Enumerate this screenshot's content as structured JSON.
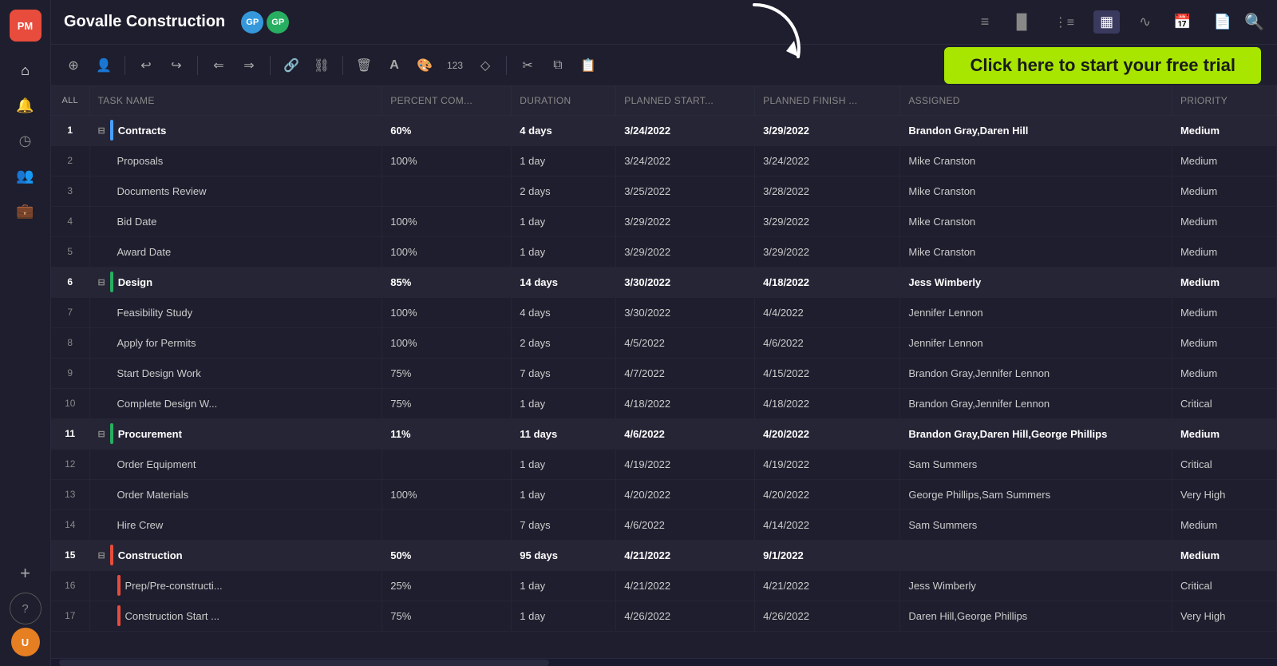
{
  "app": {
    "logo": "PM",
    "project_title": "Govalle Construction",
    "free_trial_text": "Click here to start your free trial"
  },
  "sidebar": {
    "icons": [
      {
        "name": "home-icon",
        "symbol": "⌂"
      },
      {
        "name": "bell-icon",
        "symbol": "🔔"
      },
      {
        "name": "clock-icon",
        "symbol": "◷"
      },
      {
        "name": "people-icon",
        "symbol": "👥"
      },
      {
        "name": "briefcase-icon",
        "symbol": "💼"
      }
    ],
    "bottom_icons": [
      {
        "name": "plus-icon",
        "symbol": "+"
      },
      {
        "name": "help-icon",
        "symbol": "?"
      }
    ]
  },
  "toolbar": {
    "buttons": [
      {
        "name": "add-task-btn",
        "symbol": "⊕"
      },
      {
        "name": "add-person-btn",
        "symbol": "👤"
      },
      {
        "name": "undo-btn",
        "symbol": "↩"
      },
      {
        "name": "redo-btn",
        "symbol": "↪"
      },
      {
        "name": "outdent-btn",
        "symbol": "⇐"
      },
      {
        "name": "indent-btn",
        "symbol": "⇒"
      },
      {
        "name": "link-btn",
        "symbol": "🔗"
      },
      {
        "name": "unlink-btn",
        "symbol": "⛓"
      },
      {
        "name": "delete-btn",
        "symbol": "🗑"
      },
      {
        "name": "font-btn",
        "symbol": "A"
      },
      {
        "name": "paint-btn",
        "symbol": "🎨"
      },
      {
        "name": "number-btn",
        "symbol": "123"
      },
      {
        "name": "shape-btn",
        "symbol": "◇"
      },
      {
        "name": "cut-btn",
        "symbol": "✂"
      },
      {
        "name": "copy-btn",
        "symbol": "⧉"
      },
      {
        "name": "paste-btn",
        "symbol": "📋"
      }
    ]
  },
  "header": {
    "view_icons": [
      {
        "name": "list-view-icon",
        "symbol": "≡",
        "active": false
      },
      {
        "name": "chart-view-icon",
        "symbol": "▐▌",
        "active": false
      },
      {
        "name": "gantt-view-icon",
        "symbol": "≡",
        "active": false
      },
      {
        "name": "grid-view-icon",
        "symbol": "▦",
        "active": true
      },
      {
        "name": "pulse-view-icon",
        "symbol": "∿",
        "active": false
      },
      {
        "name": "calendar-view-icon",
        "symbol": "📅",
        "active": false
      },
      {
        "name": "file-view-icon",
        "symbol": "📄",
        "active": false
      }
    ]
  },
  "table": {
    "columns": [
      {
        "key": "all",
        "label": "ALL"
      },
      {
        "key": "task_name",
        "label": "TASK NAME"
      },
      {
        "key": "percent",
        "label": "PERCENT COM..."
      },
      {
        "key": "duration",
        "label": "DURATION"
      },
      {
        "key": "planned_start",
        "label": "PLANNED START..."
      },
      {
        "key": "planned_finish",
        "label": "PLANNED FINISH ..."
      },
      {
        "key": "assigned",
        "label": "ASSIGNED"
      },
      {
        "key": "priority",
        "label": "PRIORITY"
      }
    ],
    "rows": [
      {
        "id": 1,
        "type": "group",
        "color": "blue",
        "task": "Contracts",
        "percent": "60%",
        "duration": "4 days",
        "start": "3/24/2022",
        "finish": "3/29/2022",
        "assigned": "Brandon Gray,Daren Hill",
        "priority": "Medium"
      },
      {
        "id": 2,
        "type": "task",
        "indent": true,
        "task": "Proposals",
        "percent": "100%",
        "duration": "1 day",
        "start": "3/24/2022",
        "finish": "3/24/2022",
        "assigned": "Mike Cranston",
        "priority": "Medium"
      },
      {
        "id": 3,
        "type": "task",
        "indent": true,
        "task": "Documents Review",
        "percent": "",
        "duration": "2 days",
        "start": "3/25/2022",
        "finish": "3/28/2022",
        "assigned": "Mike Cranston",
        "priority": "Medium"
      },
      {
        "id": 4,
        "type": "task",
        "indent": true,
        "task": "Bid Date",
        "percent": "100%",
        "duration": "1 day",
        "start": "3/29/2022",
        "finish": "3/29/2022",
        "assigned": "Mike Cranston",
        "priority": "Medium"
      },
      {
        "id": 5,
        "type": "task",
        "indent": true,
        "task": "Award Date",
        "percent": "100%",
        "duration": "1 day",
        "start": "3/29/2022",
        "finish": "3/29/2022",
        "assigned": "Mike Cranston",
        "priority": "Medium"
      },
      {
        "id": 6,
        "type": "group",
        "color": "green",
        "task": "Design",
        "percent": "85%",
        "duration": "14 days",
        "start": "3/30/2022",
        "finish": "4/18/2022",
        "assigned": "Jess Wimberly",
        "priority": "Medium"
      },
      {
        "id": 7,
        "type": "task",
        "indent": true,
        "task": "Feasibility Study",
        "percent": "100%",
        "duration": "4 days",
        "start": "3/30/2022",
        "finish": "4/4/2022",
        "assigned": "Jennifer Lennon",
        "priority": "Medium"
      },
      {
        "id": 8,
        "type": "task",
        "indent": true,
        "task": "Apply for Permits",
        "percent": "100%",
        "duration": "2 days",
        "start": "4/5/2022",
        "finish": "4/6/2022",
        "assigned": "Jennifer Lennon",
        "priority": "Medium"
      },
      {
        "id": 9,
        "type": "task",
        "indent": true,
        "task": "Start Design Work",
        "percent": "75%",
        "duration": "7 days",
        "start": "4/7/2022",
        "finish": "4/15/2022",
        "assigned": "Brandon Gray,Jennifer Lennon",
        "priority": "Medium"
      },
      {
        "id": 10,
        "type": "task",
        "indent": true,
        "task": "Complete Design W...",
        "percent": "75%",
        "duration": "1 day",
        "start": "4/18/2022",
        "finish": "4/18/2022",
        "assigned": "Brandon Gray,Jennifer Lennon",
        "priority": "Critical"
      },
      {
        "id": 11,
        "type": "group",
        "color": "green",
        "task": "Procurement",
        "percent": "11%",
        "duration": "11 days",
        "start": "4/6/2022",
        "finish": "4/20/2022",
        "assigned": "Brandon Gray,Daren Hill,George Phillips",
        "priority": "Medium"
      },
      {
        "id": 12,
        "type": "task",
        "indent": true,
        "task": "Order Equipment",
        "percent": "",
        "duration": "1 day",
        "start": "4/19/2022",
        "finish": "4/19/2022",
        "assigned": "Sam Summers",
        "priority": "Critical"
      },
      {
        "id": 13,
        "type": "task",
        "indent": true,
        "task": "Order Materials",
        "percent": "100%",
        "duration": "1 day",
        "start": "4/20/2022",
        "finish": "4/20/2022",
        "assigned": "George Phillips,Sam Summers",
        "priority": "Very High"
      },
      {
        "id": 14,
        "type": "task",
        "indent": true,
        "task": "Hire Crew",
        "percent": "",
        "duration": "7 days",
        "start": "4/6/2022",
        "finish": "4/14/2022",
        "assigned": "Sam Summers",
        "priority": "Medium"
      },
      {
        "id": 15,
        "type": "group",
        "color": "red",
        "task": "Construction",
        "percent": "50%",
        "duration": "95 days",
        "start": "4/21/2022",
        "finish": "9/1/2022",
        "assigned": "",
        "priority": "Medium"
      },
      {
        "id": 16,
        "type": "task",
        "indent": true,
        "color": "red",
        "task": "Prep/Pre-constructi...",
        "percent": "25%",
        "duration": "1 day",
        "start": "4/21/2022",
        "finish": "4/21/2022",
        "assigned": "Jess Wimberly",
        "priority": "Critical"
      },
      {
        "id": 17,
        "type": "task",
        "indent": true,
        "color": "red",
        "task": "Construction Start ...",
        "percent": "75%",
        "duration": "1 day",
        "start": "4/26/2022",
        "finish": "4/26/2022",
        "assigned": "Daren Hill,George Phillips",
        "priority": "Very High"
      }
    ]
  },
  "avatars": [
    {
      "initials": "GP",
      "color": "#3498db"
    },
    {
      "initials": "GP",
      "color": "#27ae60"
    }
  ]
}
